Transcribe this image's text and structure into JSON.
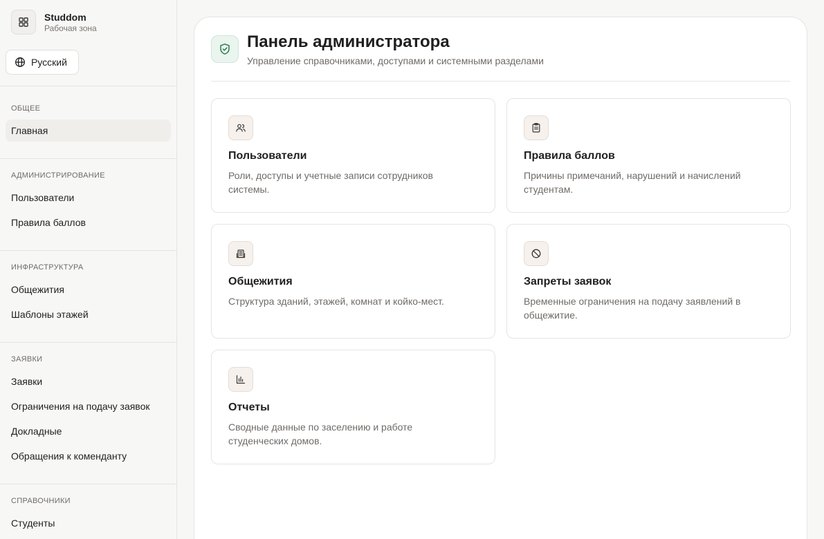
{
  "brand": {
    "name": "Studdom",
    "subtitle": "Рабочая зона",
    "icon": "grid-icon"
  },
  "language": {
    "label": "Русский",
    "icon": "globe-icon"
  },
  "sidebar": {
    "sections": [
      {
        "title": "Общее",
        "items": [
          {
            "label": "Главная",
            "active": true
          }
        ]
      },
      {
        "title": "Администрирование",
        "items": [
          {
            "label": "Пользователи"
          },
          {
            "label": "Правила баллов"
          }
        ]
      },
      {
        "title": "Инфраструктура",
        "items": [
          {
            "label": "Общежития"
          },
          {
            "label": "Шаблоны этажей"
          }
        ]
      },
      {
        "title": "Заявки",
        "items": [
          {
            "label": "Заявки"
          },
          {
            "label": "Ограничения на подачу заявок"
          },
          {
            "label": "Докладные"
          },
          {
            "label": "Обращения к коменданту"
          }
        ]
      },
      {
        "title": "Справочники",
        "items": [
          {
            "label": "Студенты"
          }
        ]
      }
    ]
  },
  "header": {
    "title": "Панель администратора",
    "subtitle": "Управление справочниками, доступами и системными разделами",
    "icon": "shield-icon"
  },
  "cards": [
    {
      "title": "Пользователи",
      "description": "Роли, доступы и учетные записи сотрудников системы.",
      "icon": "users-icon"
    },
    {
      "title": "Правила баллов",
      "description": "Причины примечаний, нарушений и начислений студентам.",
      "icon": "clipboard-icon"
    },
    {
      "title": "Общежития",
      "description": "Структура зданий, этажей, комнат и койко-мест.",
      "icon": "building-icon"
    },
    {
      "title": "Запреты заявок",
      "description": "Временные ограничения на подачу заявлений в общежитие.",
      "icon": "ban-icon"
    },
    {
      "title": "Отчеты",
      "description": "Сводные данные по заселению и работе студенческих домов.",
      "icon": "bar-chart-icon"
    }
  ],
  "colors": {
    "accent_green": "#2e7d4f",
    "card_icon_bg": "#f6f1ec",
    "active_nav_bg": "#f0eeeb"
  }
}
